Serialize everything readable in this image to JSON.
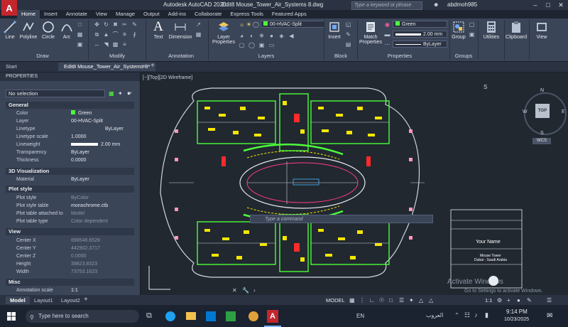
{
  "titlebar": {
    "app_title": "Autodesk AutoCAD 2020",
    "file_title": "Edit8 Mouse_Tower_Air_Systems 8.dwg",
    "search_placeholder": "Type a keyword or phrase",
    "user": "abdmoh985"
  },
  "ribbon_tabs": [
    "Home",
    "Insert",
    "Annotate",
    "View",
    "Manage",
    "Output",
    "Add-ins",
    "Collaborate",
    "Express Tools",
    "Featured Apps"
  ],
  "ribbon": {
    "draw": {
      "line": "Line",
      "polyline": "Polyline",
      "circle": "Circle",
      "arc": "Arc",
      "label": "Draw"
    },
    "modify": {
      "label": "Modify"
    },
    "annotation": {
      "text": "Text",
      "dimension": "Dimension",
      "label": "Annotation"
    },
    "layers": {
      "layer_properties": "Layer Properties",
      "current_layer": "00-HVAC-Split",
      "label": "Layers"
    },
    "block": {
      "insert": "Insert",
      "label": "Block"
    },
    "properties": {
      "match": "Match Properties",
      "color": "Green",
      "lineweight": "2.00 mm",
      "linetype": "ByLayer",
      "label": "Properties"
    },
    "groups": {
      "group": "Group",
      "label": "Groups"
    },
    "utilities": "Utilities",
    "clipboard": "Clipboard",
    "view": "View"
  },
  "doc_tabs": {
    "start": "Start",
    "active": "Edit8 Mouse_Tower_Air_Systems 8*"
  },
  "properties": {
    "title": "PROPERTIES",
    "selection": "No selection",
    "sections": {
      "general": "General",
      "viz": "3D Visualization",
      "plot": "Plot style",
      "view": "View",
      "misc": "Misc"
    },
    "general": [
      {
        "k": "Color",
        "v": "Green"
      },
      {
        "k": "Layer",
        "v": "00-HVAC-Split"
      },
      {
        "k": "Linetype",
        "v": "ByLayer"
      },
      {
        "k": "Linetype scale",
        "v": "1.0000"
      },
      {
        "k": "Lineweight",
        "v": "2.00 mm"
      },
      {
        "k": "Transparency",
        "v": "ByLayer"
      },
      {
        "k": "Thickness",
        "v": "0.0000"
      }
    ],
    "viz": [
      {
        "k": "Material",
        "v": "ByLayer"
      }
    ],
    "plot": [
      {
        "k": "Plot style",
        "v": "ByColor"
      },
      {
        "k": "Plot style table",
        "v": "monochrome.ctb"
      },
      {
        "k": "Plot table attached to",
        "v": "Model"
      },
      {
        "k": "Plot table type",
        "v": "Color dependent"
      }
    ],
    "view": [
      {
        "k": "Center X",
        "v": "698546.6528"
      },
      {
        "k": "Center Y",
        "v": "442902.3717"
      },
      {
        "k": "Center Z",
        "v": "0.0000"
      },
      {
        "k": "Height",
        "v": "39823.8323"
      },
      {
        "k": "Width",
        "v": "73753.1623"
      }
    ],
    "misc": [
      {
        "k": "Annotation scale",
        "v": "1:1"
      }
    ]
  },
  "viewport": {
    "label": "[−][Top][2D Wireframe]",
    "viewcube_top": "TOP",
    "north": "N",
    "south": "S",
    "east": "E",
    "west": "W",
    "wcs": "WCS",
    "title_block_name": "Your Name",
    "title_block_project": "Mouse Tower",
    "title_block_location": "Dubai - Saudi Arabia",
    "activate_title": "Activate Windows",
    "activate_sub": "Go to Settings to activate Windows."
  },
  "command_placeholder": "Type a command",
  "layout_tabs": [
    "Model",
    "Layout1",
    "Layout2"
  ],
  "status": {
    "model": "MODEL",
    "scale": "1:1"
  },
  "taskbar": {
    "search": "Type here to search",
    "lang": "EN",
    "arabic_lang": "العروب",
    "time": "9:14 PM",
    "date": "10/23/2025"
  },
  "colors": {
    "accent": "#c4262e",
    "drawing_green": "#4cff3a",
    "drawing_yellow": "#f5e600",
    "drawing_red": "#ff2a2a"
  }
}
